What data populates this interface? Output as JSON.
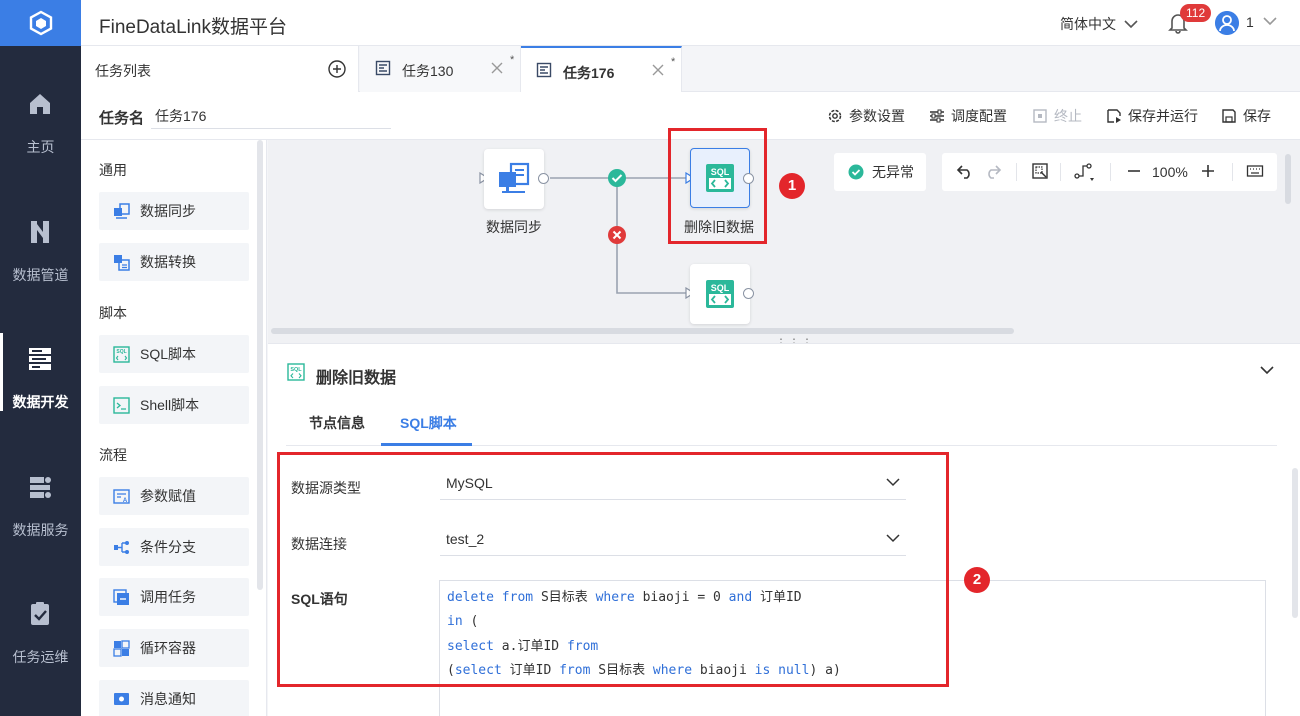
{
  "app": {
    "title": "FineDataLink数据平台"
  },
  "header": {
    "language": "简体中文",
    "notification_count": "112",
    "user_name": "1"
  },
  "nav": {
    "items": [
      {
        "label": "主页",
        "icon": "home-icon"
      },
      {
        "label": "数据管道",
        "icon": "pipeline-icon"
      },
      {
        "label": "数据开发",
        "icon": "dev-icon",
        "active": true
      },
      {
        "label": "数据服务",
        "icon": "service-icon"
      },
      {
        "label": "任务运维",
        "icon": "ops-icon"
      }
    ]
  },
  "tabs": {
    "task_list_label": "任务列表",
    "items": [
      {
        "label": "任务130",
        "modified": "*"
      },
      {
        "label": "任务176",
        "modified": "*",
        "active": true
      }
    ]
  },
  "task": {
    "name_label": "任务名",
    "name_value": "任务176",
    "toolbar": {
      "params": "参数设置",
      "schedule": "调度配置",
      "stop": "终止",
      "save_run": "保存并运行",
      "save": "保存"
    }
  },
  "palette": {
    "groups": [
      {
        "title": "通用",
        "items": [
          "数据同步",
          "数据转换"
        ]
      },
      {
        "title": "脚本",
        "items": [
          "SQL脚本",
          "Shell脚本"
        ]
      },
      {
        "title": "流程",
        "items": [
          "参数赋值",
          "条件分支",
          "调用任务",
          "循环容器",
          "消息通知"
        ]
      }
    ]
  },
  "canvas": {
    "status": "无异常",
    "zoom": "100%",
    "nodes": [
      {
        "label": "数据同步",
        "type": "sync"
      },
      {
        "label": "删除旧数据",
        "type": "sql",
        "selected": true
      },
      {
        "label": "",
        "type": "sql"
      }
    ],
    "edges": [
      {
        "from": "数据同步",
        "to": "删除旧数据",
        "condition": "success"
      },
      {
        "from": "数据同步",
        "to": "third-sql-node",
        "condition": "failure"
      }
    ]
  },
  "annotations": {
    "one": "1",
    "two": "2",
    "color": "#e3262b"
  },
  "detail": {
    "title": "删除旧数据",
    "tabs": [
      "节点信息",
      "SQL脚本"
    ],
    "active_tab": "SQL脚本",
    "form": {
      "datasource_type_label": "数据源类型",
      "datasource_type_value": "MySQL",
      "connection_label": "数据连接",
      "connection_value": "test_2",
      "sql_label": "SQL语句",
      "sql_lines": [
        "delete from S目标表 where biaoji = 0 and 订单ID",
        "in (",
        "select a.订单ID from",
        "(select 订单ID from S目标表 where biaoji is null) a)"
      ]
    }
  },
  "colors": {
    "accent": "#3b7ee5",
    "nav_bg": "#232b3e",
    "success": "#2bb89a",
    "error": "#e03a3a"
  }
}
